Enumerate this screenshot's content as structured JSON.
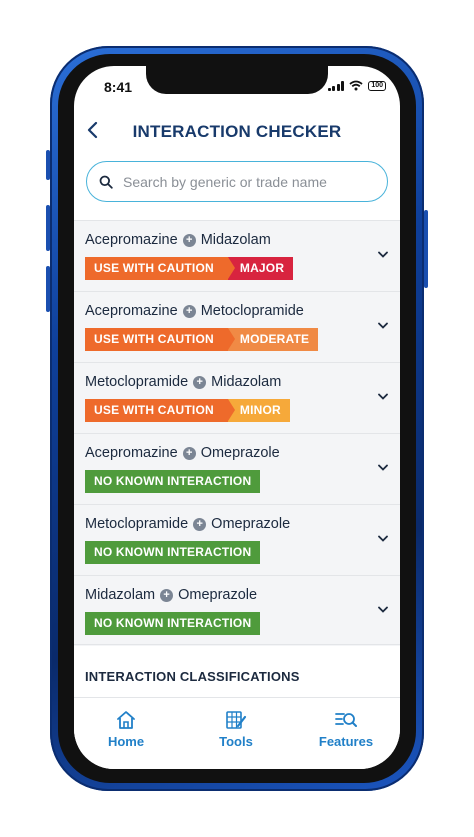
{
  "status_bar": {
    "time": "8:41",
    "battery": "100"
  },
  "header": {
    "title": "INTERACTION CHECKER"
  },
  "search": {
    "placeholder": "Search by generic or trade name"
  },
  "interactions": [
    {
      "drug_a": "Acepromazine",
      "drug_b": "Midazolam",
      "status": "USE WITH CAUTION",
      "severity": "MAJOR",
      "severity_color": "#d8243f"
    },
    {
      "drug_a": "Acepromazine",
      "drug_b": "Metoclopramide",
      "status": "USE WITH CAUTION",
      "severity": "MODERATE",
      "severity_color": "#f08a45"
    },
    {
      "drug_a": "Metoclopramide",
      "drug_b": "Midazolam",
      "status": "USE WITH CAUTION",
      "severity": "MINOR",
      "severity_color": "#f6a93a"
    },
    {
      "drug_a": "Acepromazine",
      "drug_b": "Omeprazole",
      "status": "NO KNOWN INTERACTION"
    },
    {
      "drug_a": "Metoclopramide",
      "drug_b": "Omeprazole",
      "status": "NO KNOWN INTERACTION"
    },
    {
      "drug_a": "Midazolam",
      "drug_b": "Omeprazole",
      "status": "NO KNOWN INTERACTION"
    }
  ],
  "section": {
    "title": "INTERACTION CLASSIFICATIONS"
  },
  "tabs": [
    {
      "label": "Home",
      "icon": "home-icon"
    },
    {
      "label": "Tools",
      "icon": "tools-icon"
    },
    {
      "label": "Features",
      "icon": "features-icon"
    }
  ],
  "colors": {
    "accent": "#2180c8",
    "caution": "#ee6a2b",
    "no_interaction": "#4f9b3c",
    "title": "#183a6b"
  }
}
